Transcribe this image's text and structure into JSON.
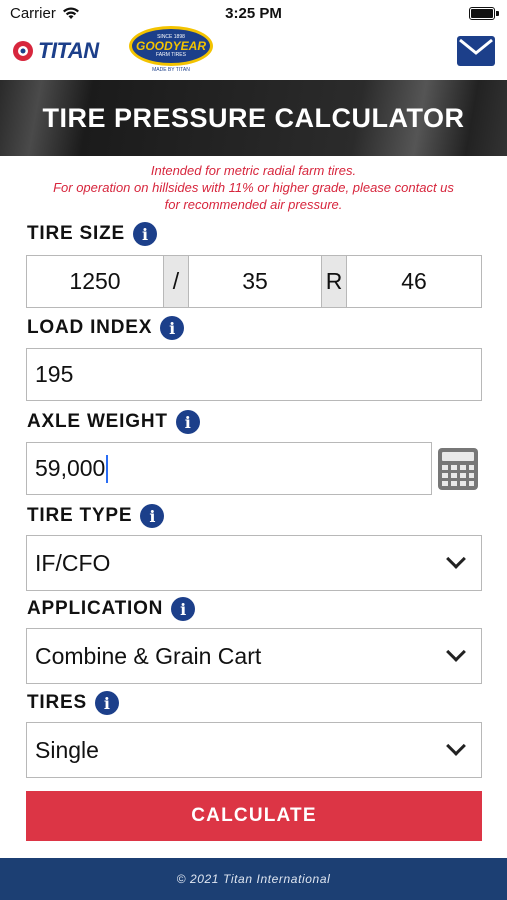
{
  "status": {
    "carrier": "Carrier",
    "time": "3:25 PM",
    "battery_level": 1.0
  },
  "header": {
    "titan_logo_text": "TITAN",
    "goodyear_logo_text": "GOODYEAR",
    "goodyear_logo_sub": "FARM TIRES",
    "goodyear_logo_since": "SINCE 1898",
    "goodyear_logo_tag": "MADE BY TITAN"
  },
  "banner": {
    "title": "TIRE PRESSURE CALCULATOR"
  },
  "notice": {
    "line1": "Intended for metric radial farm tires.",
    "line2": "For operation on hillsides with 11% or higher grade, please contact us",
    "line3": "for recommended air pressure."
  },
  "form": {
    "tire_size": {
      "label": "TIRE SIZE",
      "width": "1250",
      "sep1": "/",
      "aspect": "35",
      "sep2": "R",
      "rim": "46"
    },
    "load_index": {
      "label": "LOAD INDEX",
      "value": "195"
    },
    "axle_weight": {
      "label": "AXLE WEIGHT",
      "value": "59,000"
    },
    "tire_type": {
      "label": "TIRE TYPE",
      "value": "IF/CFO"
    },
    "application": {
      "label": "APPLICATION",
      "value": "Combine & Grain Cart"
    },
    "tires": {
      "label": "TIRES",
      "value": "Single"
    },
    "info_glyph": "i",
    "calculate_label": "CALCULATE"
  },
  "footer": {
    "text": "© 2021 Titan International"
  },
  "colors": {
    "brand_blue": "#1c3f8a",
    "accent_red": "#dc3545",
    "notice_red": "#d7263d",
    "footer_blue": "#1c3f73"
  }
}
